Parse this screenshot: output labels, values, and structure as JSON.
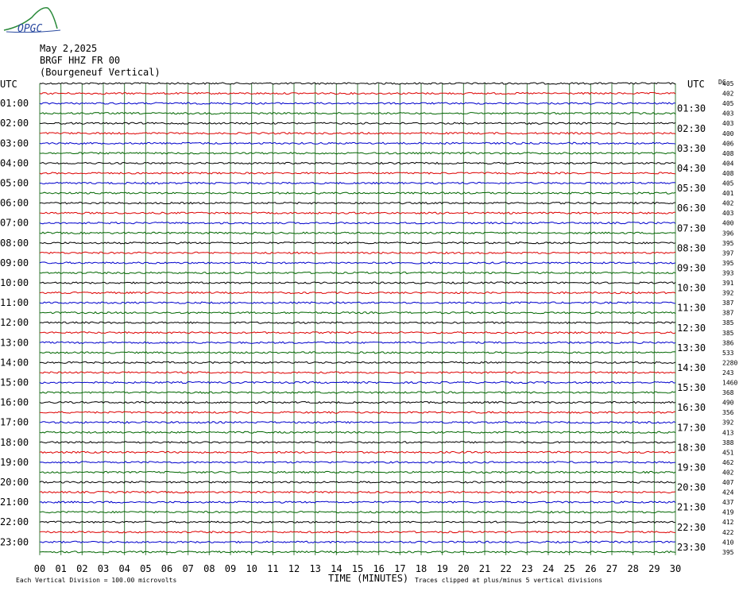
{
  "header": {
    "logo_text": "OPGC",
    "date": "May 2,2025",
    "station": "BRGF HHZ FR 00",
    "location": "(Bourgeneuf Vertical)"
  },
  "footer": {
    "scale_note": "Each Vertical Division =  100.00 microvolts",
    "clip_note": "Traces clipped at plus/minus 5 vertical divisions"
  },
  "chart_data": {
    "type": "line",
    "title": "",
    "xlabel": "TIME (MINUTES)",
    "ylabel": "",
    "left_axis_title": "UTC",
    "right_axis_title": "UTC",
    "dc_title": "DC",
    "xlim": [
      0,
      30
    ],
    "x_ticks": [
      "00",
      "01",
      "02",
      "03",
      "04",
      "05",
      "06",
      "07",
      "08",
      "09",
      "10",
      "11",
      "12",
      "13",
      "14",
      "15",
      "16",
      "17",
      "18",
      "19",
      "20",
      "21",
      "22",
      "23",
      "24",
      "25",
      "26",
      "27",
      "28",
      "29",
      "30"
    ],
    "grid": true,
    "trace_colors": [
      "#000000",
      "#dd0000",
      "#0000cc",
      "#006600"
    ],
    "left_hour_labels": [
      "UTC",
      "01:00",
      "02:00",
      "03:00",
      "04:00",
      "05:00",
      "06:00",
      "07:00",
      "08:00",
      "09:00",
      "10:00",
      "11:00",
      "12:00",
      "13:00",
      "14:00",
      "15:00",
      "16:00",
      "17:00",
      "18:00",
      "19:00",
      "20:00",
      "21:00",
      "22:00",
      "23:00"
    ],
    "right_hour_labels": [
      "UTC",
      "01:30",
      "02:30",
      "03:30",
      "04:30",
      "05:30",
      "06:30",
      "07:30",
      "08:30",
      "09:30",
      "10:30",
      "11:30",
      "12:30",
      "13:30",
      "14:30",
      "15:30",
      "16:30",
      "17:30",
      "18:30",
      "19:30",
      "20:30",
      "21:30",
      "22:30",
      "23:30"
    ],
    "dc_offsets": [
      405,
      402,
      405,
      403,
      403,
      400,
      406,
      408,
      404,
      408,
      405,
      401,
      402,
      403,
      400,
      396,
      395,
      397,
      395,
      393,
      391,
      392,
      387,
      387,
      385,
      385,
      386,
      533,
      2280,
      243,
      1460,
      368,
      490,
      356,
      392,
      413,
      388,
      451,
      462,
      402,
      407,
      424,
      437,
      419,
      412,
      422,
      410,
      395
    ],
    "traces": {
      "rows": 48,
      "minutes_per_row": 30,
      "activity_levels": [
        1,
        1,
        1,
        1,
        1,
        1,
        1,
        1,
        1,
        1,
        1,
        1,
        1,
        1,
        1,
        1,
        1,
        1,
        1,
        1,
        1,
        1,
        1,
        1,
        1,
        1,
        1,
        1,
        1,
        1,
        1,
        1,
        1,
        1,
        1,
        1,
        1,
        1,
        1,
        1,
        1,
        1,
        1,
        1,
        1,
        1,
        1,
        1
      ]
    }
  }
}
